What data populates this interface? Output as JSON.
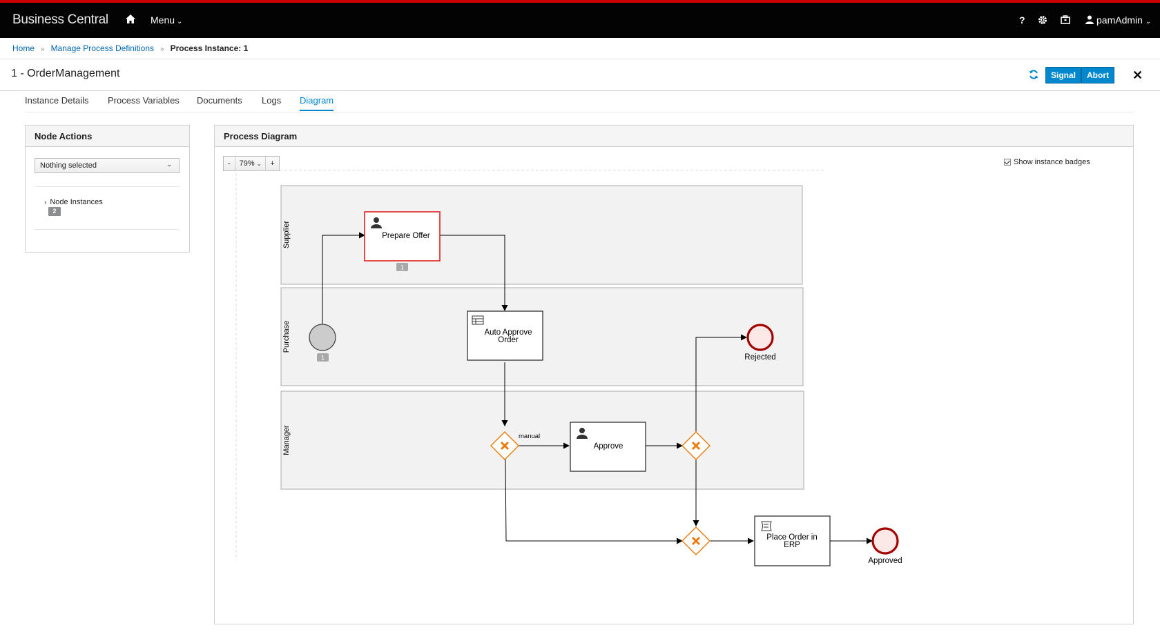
{
  "app": {
    "title": "Business Central"
  },
  "topbar": {
    "menu_label": "Menu",
    "help_label": "?",
    "user_label": "pamAdmin"
  },
  "breadcrumb": {
    "home": "Home",
    "definitions": "Manage Process Definitions",
    "current": "Process Instance: 1"
  },
  "header": {
    "title": "1 - OrderManagement",
    "signal_label": "Signal",
    "abort_label": "Abort"
  },
  "tabs": [
    {
      "label": "Instance Details",
      "active": false
    },
    {
      "label": "Process Variables",
      "active": false
    },
    {
      "label": "Documents",
      "active": false
    },
    {
      "label": "Logs",
      "active": false
    },
    {
      "label": "Diagram",
      "active": true
    }
  ],
  "node_actions": {
    "title": "Node Actions",
    "select_value": "Nothing selected",
    "node_instances_label": "Node Instances",
    "node_instances_count": "2"
  },
  "diagram": {
    "title": "Process Diagram",
    "zoom": {
      "minus": "-",
      "level": "79%",
      "plus": "+"
    },
    "show_badges_label": "Show instance badges",
    "show_badges_checked": true,
    "lanes": {
      "supplier": "Supplier",
      "purchase": "Purchase",
      "manager": "Manager"
    },
    "tasks": {
      "prepare_offer": "Prepare Offer",
      "auto_approve_line1": "Auto Approve",
      "auto_approve_line2": "Order",
      "approve": "Approve",
      "place_order_line1": "Place Order in",
      "place_order_line2": "ERP"
    },
    "events": {
      "rejected": "Rejected",
      "approved": "Approved"
    },
    "edge_labels": {
      "manual": "manual"
    },
    "badges": {
      "prepare_offer": "1",
      "start": "1"
    },
    "colors": {
      "active_border": "#e02020",
      "gateway": "#ec7a08",
      "end_event": "#a30000",
      "end_fill": "#fde8e8",
      "start_fill": "#cccccc"
    }
  }
}
